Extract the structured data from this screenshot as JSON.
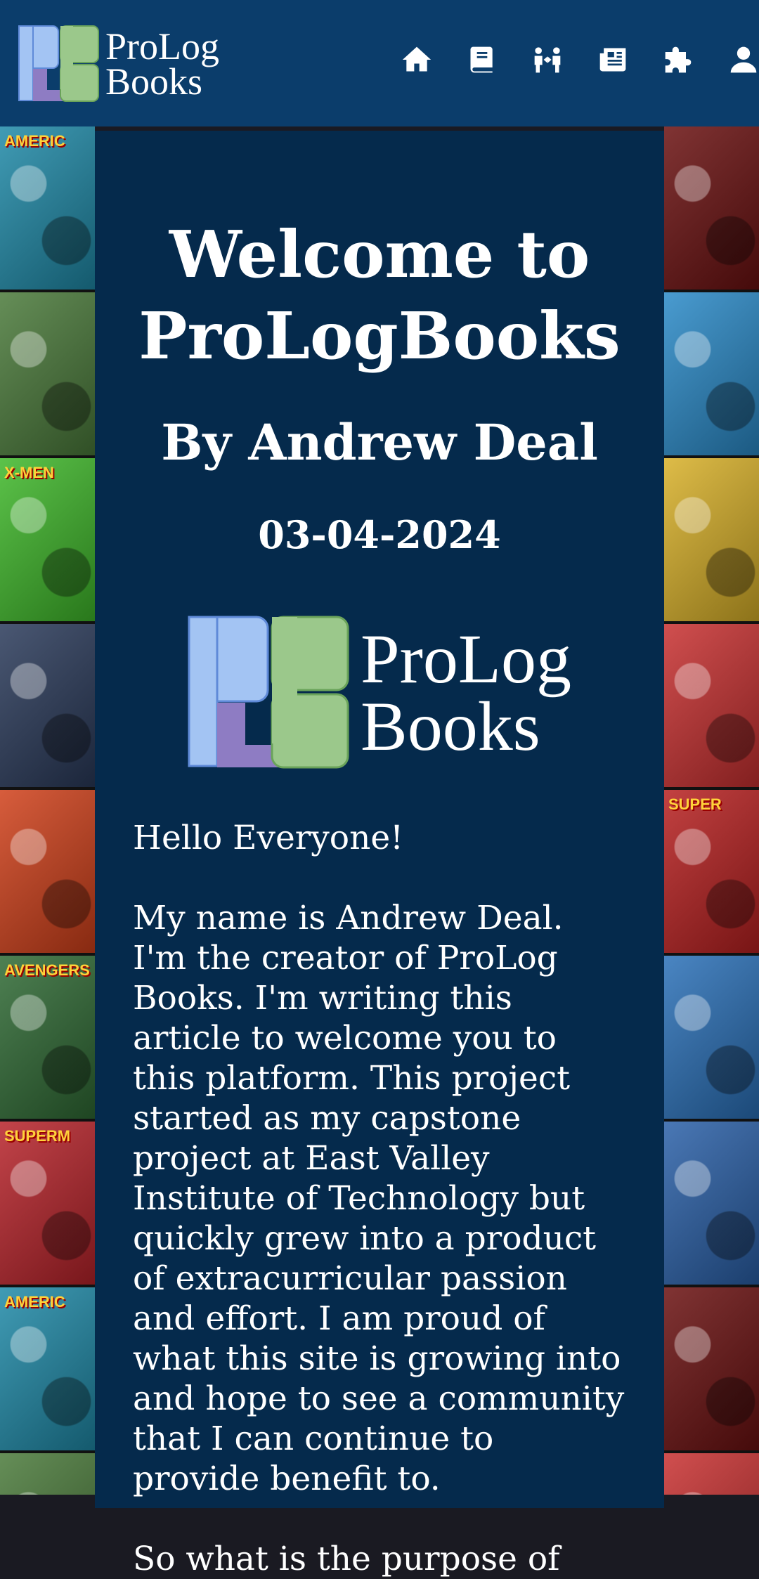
{
  "brand": {
    "logo_line1": "ProLog",
    "logo_line2": "Books",
    "colors": {
      "blue": "#a3c4f3",
      "purple": "#8e7cc3",
      "green": "#9bc88b",
      "header": "#0b3d6b",
      "card": "#052a4c"
    }
  },
  "nav": [
    {
      "icon": "home-icon"
    },
    {
      "icon": "book-icon"
    },
    {
      "icon": "community-icon"
    },
    {
      "icon": "newspaper-icon"
    },
    {
      "icon": "puzzle-icon"
    },
    {
      "icon": "user-icon"
    }
  ],
  "article": {
    "title": "Welcome to ProLogBooks",
    "author": "By Andrew Deal",
    "date": "03-04-2024",
    "paragraphs": [
      "Hello Everyone!",
      "My name is Andrew Deal. I'm the creator of ProLog Books. I'm writing this article to welcome you to this platform. This project started as my capstone project at East Valley Institute of Technology but quickly grew into a product of extracurricular passion and effort. I am proud of what this site is growing into and hope to see a community that I can continue to provide benefit to.",
      "So what is the purpose of"
    ]
  }
}
